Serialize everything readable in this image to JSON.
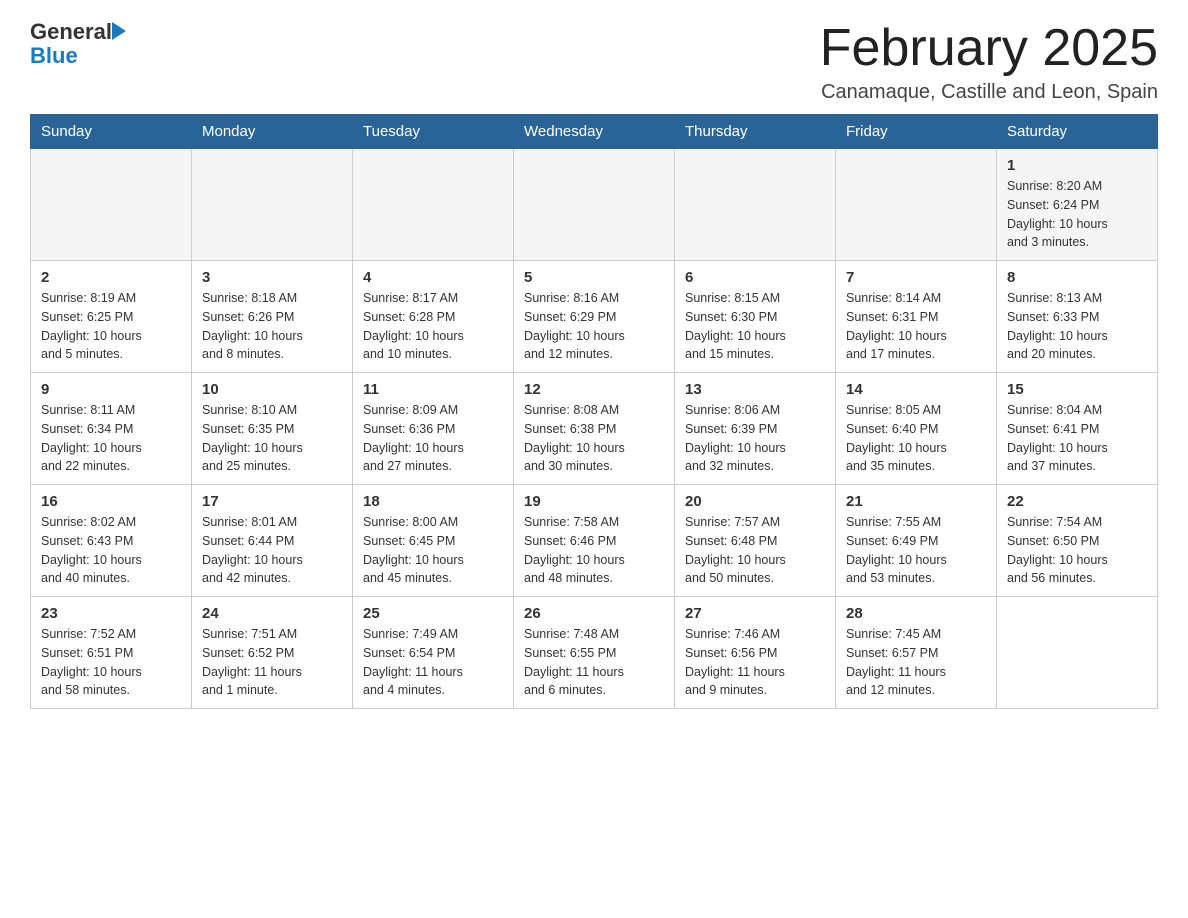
{
  "header": {
    "logo_general": "General",
    "logo_blue": "Blue",
    "month_title": "February 2025",
    "location": "Canamaque, Castille and Leon, Spain"
  },
  "weekdays": [
    "Sunday",
    "Monday",
    "Tuesday",
    "Wednesday",
    "Thursday",
    "Friday",
    "Saturday"
  ],
  "weeks": [
    [
      {
        "day": "",
        "info": ""
      },
      {
        "day": "",
        "info": ""
      },
      {
        "day": "",
        "info": ""
      },
      {
        "day": "",
        "info": ""
      },
      {
        "day": "",
        "info": ""
      },
      {
        "day": "",
        "info": ""
      },
      {
        "day": "1",
        "info": "Sunrise: 8:20 AM\nSunset: 6:24 PM\nDaylight: 10 hours\nand 3 minutes."
      }
    ],
    [
      {
        "day": "2",
        "info": "Sunrise: 8:19 AM\nSunset: 6:25 PM\nDaylight: 10 hours\nand 5 minutes."
      },
      {
        "day": "3",
        "info": "Sunrise: 8:18 AM\nSunset: 6:26 PM\nDaylight: 10 hours\nand 8 minutes."
      },
      {
        "day": "4",
        "info": "Sunrise: 8:17 AM\nSunset: 6:28 PM\nDaylight: 10 hours\nand 10 minutes."
      },
      {
        "day": "5",
        "info": "Sunrise: 8:16 AM\nSunset: 6:29 PM\nDaylight: 10 hours\nand 12 minutes."
      },
      {
        "day": "6",
        "info": "Sunrise: 8:15 AM\nSunset: 6:30 PM\nDaylight: 10 hours\nand 15 minutes."
      },
      {
        "day": "7",
        "info": "Sunrise: 8:14 AM\nSunset: 6:31 PM\nDaylight: 10 hours\nand 17 minutes."
      },
      {
        "day": "8",
        "info": "Sunrise: 8:13 AM\nSunset: 6:33 PM\nDaylight: 10 hours\nand 20 minutes."
      }
    ],
    [
      {
        "day": "9",
        "info": "Sunrise: 8:11 AM\nSunset: 6:34 PM\nDaylight: 10 hours\nand 22 minutes."
      },
      {
        "day": "10",
        "info": "Sunrise: 8:10 AM\nSunset: 6:35 PM\nDaylight: 10 hours\nand 25 minutes."
      },
      {
        "day": "11",
        "info": "Sunrise: 8:09 AM\nSunset: 6:36 PM\nDaylight: 10 hours\nand 27 minutes."
      },
      {
        "day": "12",
        "info": "Sunrise: 8:08 AM\nSunset: 6:38 PM\nDaylight: 10 hours\nand 30 minutes."
      },
      {
        "day": "13",
        "info": "Sunrise: 8:06 AM\nSunset: 6:39 PM\nDaylight: 10 hours\nand 32 minutes."
      },
      {
        "day": "14",
        "info": "Sunrise: 8:05 AM\nSunset: 6:40 PM\nDaylight: 10 hours\nand 35 minutes."
      },
      {
        "day": "15",
        "info": "Sunrise: 8:04 AM\nSunset: 6:41 PM\nDaylight: 10 hours\nand 37 minutes."
      }
    ],
    [
      {
        "day": "16",
        "info": "Sunrise: 8:02 AM\nSunset: 6:43 PM\nDaylight: 10 hours\nand 40 minutes."
      },
      {
        "day": "17",
        "info": "Sunrise: 8:01 AM\nSunset: 6:44 PM\nDaylight: 10 hours\nand 42 minutes."
      },
      {
        "day": "18",
        "info": "Sunrise: 8:00 AM\nSunset: 6:45 PM\nDaylight: 10 hours\nand 45 minutes."
      },
      {
        "day": "19",
        "info": "Sunrise: 7:58 AM\nSunset: 6:46 PM\nDaylight: 10 hours\nand 48 minutes."
      },
      {
        "day": "20",
        "info": "Sunrise: 7:57 AM\nSunset: 6:48 PM\nDaylight: 10 hours\nand 50 minutes."
      },
      {
        "day": "21",
        "info": "Sunrise: 7:55 AM\nSunset: 6:49 PM\nDaylight: 10 hours\nand 53 minutes."
      },
      {
        "day": "22",
        "info": "Sunrise: 7:54 AM\nSunset: 6:50 PM\nDaylight: 10 hours\nand 56 minutes."
      }
    ],
    [
      {
        "day": "23",
        "info": "Sunrise: 7:52 AM\nSunset: 6:51 PM\nDaylight: 10 hours\nand 58 minutes."
      },
      {
        "day": "24",
        "info": "Sunrise: 7:51 AM\nSunset: 6:52 PM\nDaylight: 11 hours\nand 1 minute."
      },
      {
        "day": "25",
        "info": "Sunrise: 7:49 AM\nSunset: 6:54 PM\nDaylight: 11 hours\nand 4 minutes."
      },
      {
        "day": "26",
        "info": "Sunrise: 7:48 AM\nSunset: 6:55 PM\nDaylight: 11 hours\nand 6 minutes."
      },
      {
        "day": "27",
        "info": "Sunrise: 7:46 AM\nSunset: 6:56 PM\nDaylight: 11 hours\nand 9 minutes."
      },
      {
        "day": "28",
        "info": "Sunrise: 7:45 AM\nSunset: 6:57 PM\nDaylight: 11 hours\nand 12 minutes."
      },
      {
        "day": "",
        "info": ""
      }
    ]
  ]
}
